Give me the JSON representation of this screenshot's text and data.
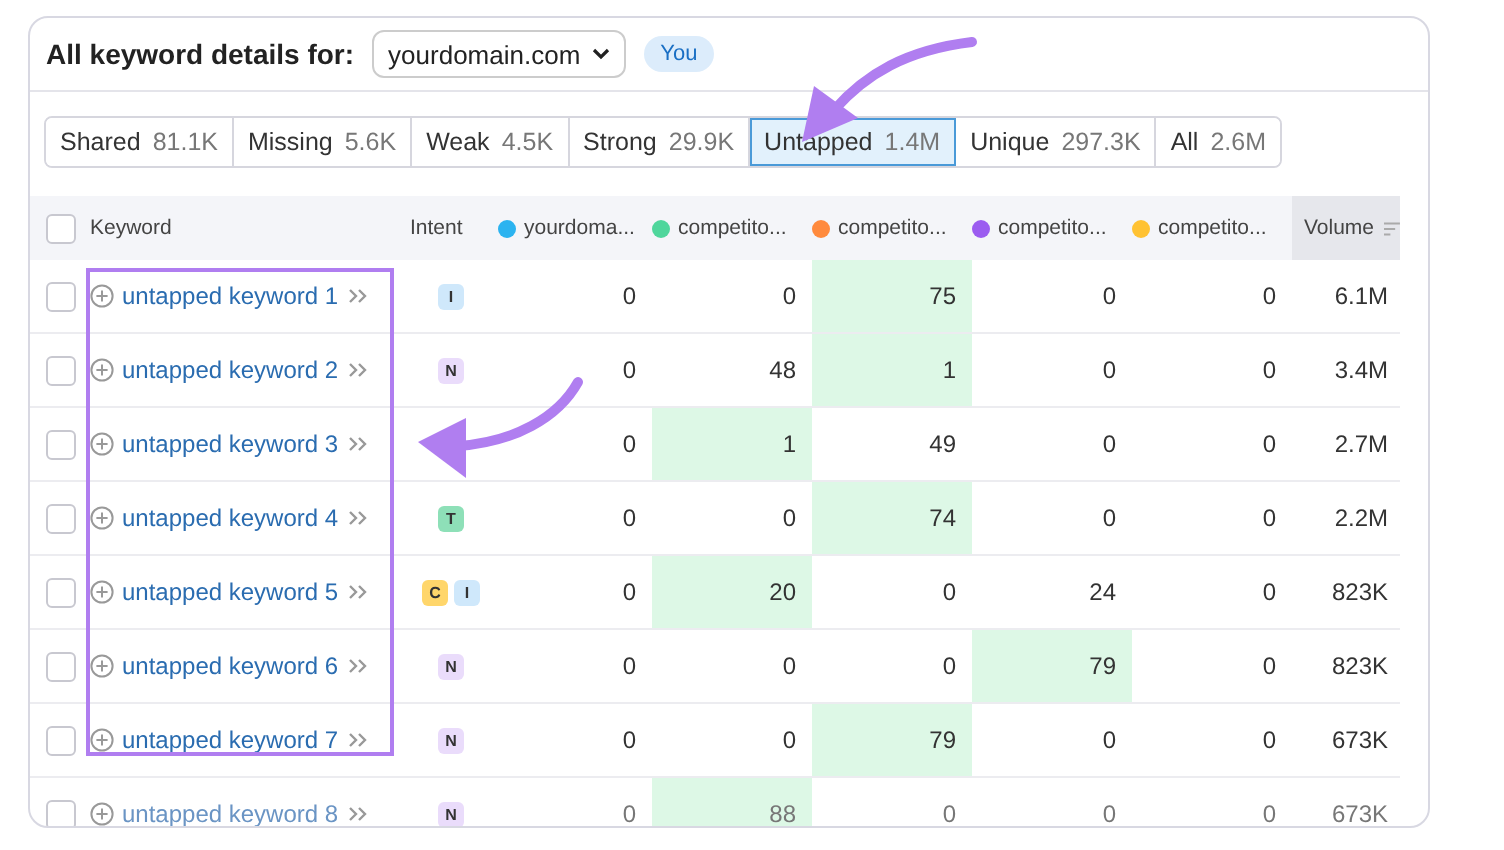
{
  "header": {
    "title": "All keyword details for:",
    "domain_select": "yourdomain.com",
    "badge": "You"
  },
  "tabs": [
    {
      "label": "Shared",
      "count": "81.1K",
      "selected": false
    },
    {
      "label": "Missing",
      "count": "5.6K",
      "selected": false
    },
    {
      "label": "Weak",
      "count": "4.5K",
      "selected": false
    },
    {
      "label": "Strong",
      "count": "29.9K",
      "selected": false
    },
    {
      "label": "Untapped",
      "count": "1.4M",
      "selected": true
    },
    {
      "label": "Unique",
      "count": "297.3K",
      "selected": false
    },
    {
      "label": "All",
      "count": "2.6M",
      "selected": false
    }
  ],
  "table": {
    "select_all_checked": false,
    "columns": [
      {
        "label": "Keyword"
      },
      {
        "label": "Intent"
      },
      {
        "label": "yourdoma...",
        "color": "#2bb3f0"
      },
      {
        "label": "competito...",
        "color": "#4fd69c"
      },
      {
        "label": "competito...",
        "color": "#ff8a3d"
      },
      {
        "label": "competito...",
        "color": "#9b5cf0"
      },
      {
        "label": "competito...",
        "color": "#ffc233"
      },
      {
        "label": "Volume"
      }
    ],
    "rows": [
      {
        "checked": false,
        "keyword": "untapped keyword 1",
        "intents": [
          {
            "letter": "I",
            "color": "#cfe8fb"
          }
        ],
        "positions": [
          {
            "value": "0",
            "best": false
          },
          {
            "value": "0",
            "best": false
          },
          {
            "value": "75",
            "best": true
          },
          {
            "value": "0",
            "best": false
          },
          {
            "value": "0",
            "best": false
          }
        ],
        "volume": "6.1M",
        "faded": false
      },
      {
        "checked": false,
        "keyword": "untapped keyword 2",
        "intents": [
          {
            "letter": "N",
            "color": "#eadcfb"
          }
        ],
        "positions": [
          {
            "value": "0",
            "best": false
          },
          {
            "value": "48",
            "best": false
          },
          {
            "value": "1",
            "best": true
          },
          {
            "value": "0",
            "best": false
          },
          {
            "value": "0",
            "best": false
          }
        ],
        "volume": "3.4M",
        "faded": false
      },
      {
        "checked": false,
        "keyword": "untapped keyword 3",
        "intents": [],
        "positions": [
          {
            "value": "0",
            "best": false
          },
          {
            "value": "1",
            "best": true
          },
          {
            "value": "49",
            "best": false
          },
          {
            "value": "0",
            "best": false
          },
          {
            "value": "0",
            "best": false
          }
        ],
        "volume": "2.7M",
        "faded": false
      },
      {
        "checked": false,
        "keyword": "untapped keyword 4",
        "intents": [
          {
            "letter": "T",
            "color": "#8ee0b8"
          }
        ],
        "positions": [
          {
            "value": "0",
            "best": false
          },
          {
            "value": "0",
            "best": false
          },
          {
            "value": "74",
            "best": true
          },
          {
            "value": "0",
            "best": false
          },
          {
            "value": "0",
            "best": false
          }
        ],
        "volume": "2.2M",
        "faded": false
      },
      {
        "checked": false,
        "keyword": "untapped keyword 5",
        "intents": [
          {
            "letter": "C",
            "color": "#ffd66b"
          },
          {
            "letter": "I",
            "color": "#cfe8fb"
          }
        ],
        "positions": [
          {
            "value": "0",
            "best": false
          },
          {
            "value": "20",
            "best": true
          },
          {
            "value": "0",
            "best": false
          },
          {
            "value": "24",
            "best": false
          },
          {
            "value": "0",
            "best": false
          }
        ],
        "volume": "823K",
        "faded": false
      },
      {
        "checked": false,
        "keyword": "untapped keyword 6",
        "intents": [
          {
            "letter": "N",
            "color": "#eadcfb"
          }
        ],
        "positions": [
          {
            "value": "0",
            "best": false
          },
          {
            "value": "0",
            "best": false
          },
          {
            "value": "0",
            "best": false
          },
          {
            "value": "79",
            "best": true
          },
          {
            "value": "0",
            "best": false
          }
        ],
        "volume": "823K",
        "faded": false
      },
      {
        "checked": false,
        "keyword": "untapped keyword 7",
        "intents": [
          {
            "letter": "N",
            "color": "#eadcfb"
          }
        ],
        "positions": [
          {
            "value": "0",
            "best": false
          },
          {
            "value": "0",
            "best": false
          },
          {
            "value": "79",
            "best": true
          },
          {
            "value": "0",
            "best": false
          },
          {
            "value": "0",
            "best": false
          }
        ],
        "volume": "673K",
        "faded": false
      },
      {
        "checked": false,
        "keyword": "untapped keyword 8",
        "intents": [
          {
            "letter": "N",
            "color": "#eadcfb"
          }
        ],
        "positions": [
          {
            "value": "0",
            "best": false
          },
          {
            "value": "88",
            "best": true
          },
          {
            "value": "0",
            "best": false
          },
          {
            "value": "0",
            "best": false
          },
          {
            "value": "0",
            "best": false
          }
        ],
        "volume": "673K",
        "faded": true
      }
    ]
  }
}
